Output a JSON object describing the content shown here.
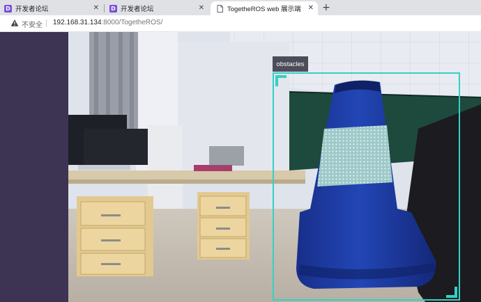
{
  "browser": {
    "tabs": [
      {
        "favicon_letter": "D",
        "title": "开发者论坛",
        "active": false
      },
      {
        "favicon_letter": "D",
        "title": "开发者论坛",
        "active": false
      },
      {
        "title": "TogetheROS web 展示端",
        "active": true
      }
    ],
    "security_label": "不安全",
    "url_host": "192.168.31.134",
    "url_path": ":8000/TogetheROS/"
  },
  "detection": {
    "label": "obstacles",
    "box_color": "#35d0c4"
  },
  "colors": {
    "sidebar": "#3c3452",
    "label_bg": "#4c4c5a"
  }
}
